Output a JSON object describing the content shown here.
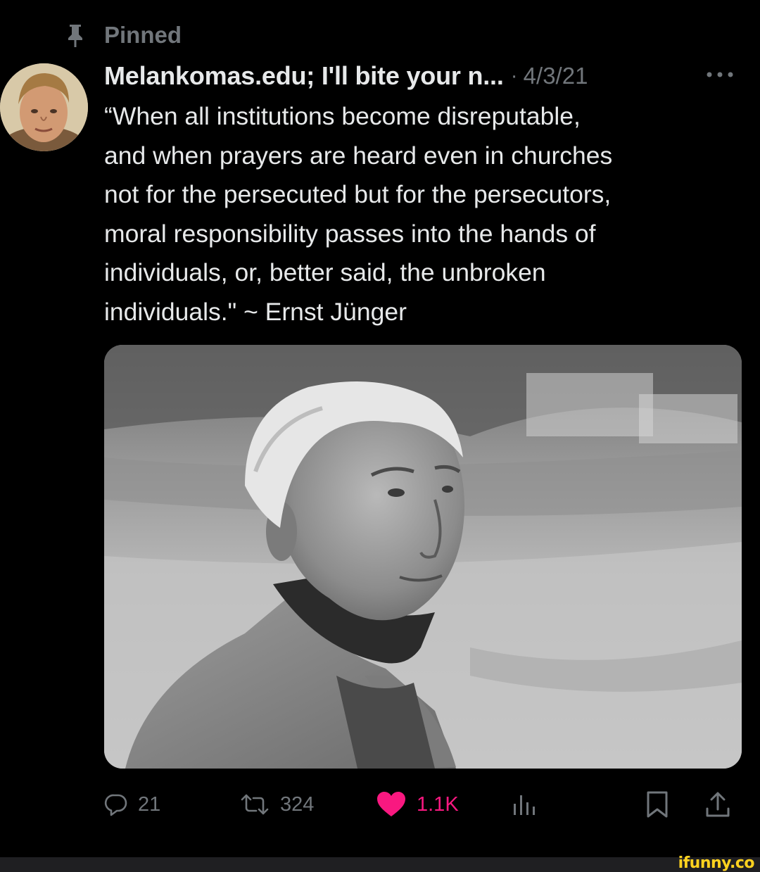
{
  "pinned": {
    "label": "Pinned"
  },
  "author": {
    "display_name": "Melankomas.edu; I'll bite your n...",
    "separator": "·",
    "date": "4/3/21"
  },
  "tweet": {
    "text": "“When all institutions become disreputable,\nand when prayers are heard even in churches\nnot for the persecuted but for the persecutors,\nmoral responsibility passes into the hands of\nindividuals, or, better said, the unbroken\nindividuals.\" ~ Ernst Jünger"
  },
  "actions": {
    "replies": "21",
    "retweets": "324",
    "likes": "1.1K"
  },
  "colors": {
    "background": "#000000",
    "text_primary": "#e7e9ea",
    "text_secondary": "#71767b",
    "like_pink": "#f91880",
    "watermark_yellow": "#ffd21f"
  },
  "icons": {
    "pin": "pin-icon",
    "more": "more-icon",
    "reply": "reply-icon",
    "retweet": "retweet-icon",
    "like": "heart-icon",
    "views": "views-icon",
    "bookmark": "bookmark-icon",
    "share": "share-icon"
  },
  "watermark": "ifunny.co"
}
